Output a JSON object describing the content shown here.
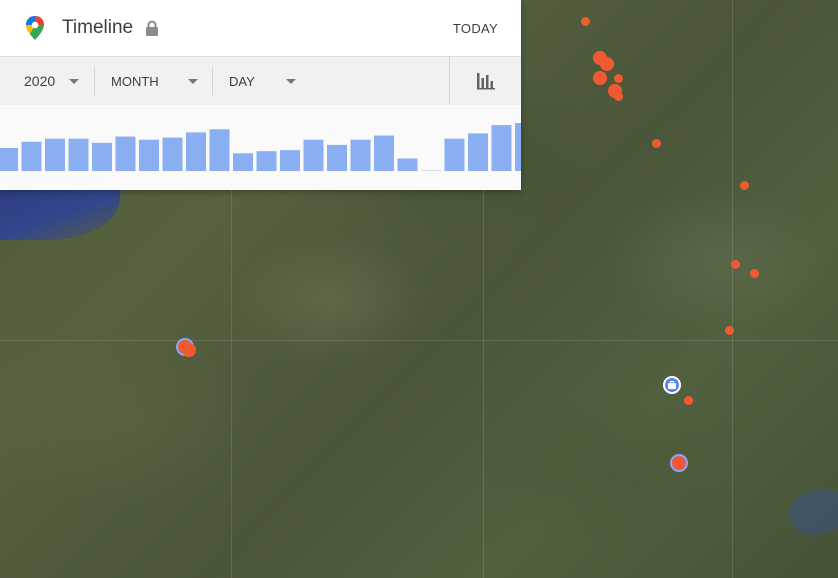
{
  "header": {
    "title": "Timeline",
    "today_label": "TODAY"
  },
  "filters": {
    "year": "2020",
    "month": "MONTH",
    "day": "DAY"
  },
  "icons": {
    "logo": "google-maps-pin-icon",
    "lock": "lock-icon",
    "chart": "bar-chart-icon",
    "work": "briefcase-icon"
  },
  "colors": {
    "bar": "#8aaef2",
    "location_dot": "#ef5a33",
    "place_pin": "#5a84f0"
  },
  "chart_data": {
    "type": "bar",
    "values": [
      22,
      28,
      31,
      31,
      27,
      33,
      30,
      32,
      37,
      40,
      17,
      19,
      20,
      30,
      25,
      30,
      34,
      12,
      0,
      31,
      36,
      44,
      46
    ]
  }
}
